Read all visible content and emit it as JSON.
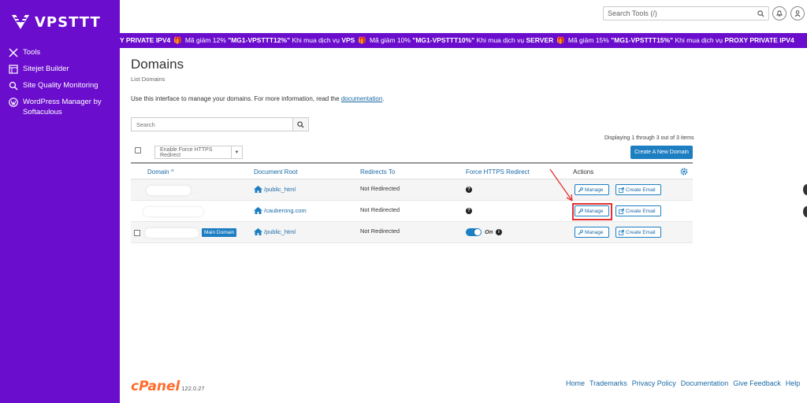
{
  "sidebar": {
    "brand": "VPSTTT",
    "items": [
      {
        "label": "Tools",
        "icon": "tools-icon"
      },
      {
        "label": "Sitejet Builder",
        "icon": "sitejet-icon"
      },
      {
        "label": "Site Quality Monitoring",
        "icon": "search-monitor-icon"
      },
      {
        "label": "WordPress Manager by Softaculous",
        "icon": "wordpress-icon"
      }
    ]
  },
  "topbar": {
    "search_placeholder": "Search Tools (/)"
  },
  "promo": {
    "p1": "Y PRIVATE IPV4",
    "p2": "Mã giảm 12%",
    "p3": "\"MG1-VPSTTT12%\"",
    "p4": "Khi mua dịch vụ",
    "p5": "VPS",
    "p6": "Mã giảm 10%",
    "p7": "\"MG1-VPSTTT10%\"",
    "p8": "Khi mua dịch vụ",
    "p9": "SERVER",
    "p10": "Mã giảm 15%",
    "p11": "\"MG1-VPSTTT15%\"",
    "p12": "Khi mua dịch vụ",
    "p13": "PROXY PRIVATE IPV4"
  },
  "main": {
    "title": "Domains",
    "subtitle": "List Domains",
    "intro_text": "Use this interface to manage your domains. For more information, read the",
    "intro_link": "documentation",
    "intro_end": ".",
    "search_placeholder": "Search",
    "displaying": "Displaying 1 through 3 out of 3 items",
    "bulk_action": "Enable Force HTTPS Redirect",
    "create_button": "Create A New Domain"
  },
  "table": {
    "headers": {
      "domain": "Domain",
      "domain_sort": "^",
      "docroot": "Document Root",
      "redirects": "Redirects To",
      "https": "Force HTTPS Redirect",
      "actions": "Actions"
    },
    "rows": [
      {
        "docroot": "/public_html",
        "redirect": "Not Redirected",
        "manage": "Manage",
        "email": "Create Email"
      },
      {
        "docroot": "/cauberong.com",
        "redirect": "Not Redirected",
        "manage": "Manage",
        "email": "Create Email"
      },
      {
        "docroot": "/public_html",
        "redirect": "Not Redirected",
        "badge": "Main Domain",
        "https_state": "On",
        "manage": "Manage",
        "email": "Create Email"
      }
    ]
  },
  "footer": {
    "logo": "cPanel",
    "version": "122.0.27",
    "links": [
      "Home",
      "Trademarks",
      "Privacy Policy",
      "Documentation",
      "Give Feedback",
      "Help"
    ]
  },
  "colors": {
    "sidebar": "#6a0dcc",
    "accent": "#1d7ec2",
    "cpanel": "#ff6c2c",
    "highlight": "#e53030"
  }
}
